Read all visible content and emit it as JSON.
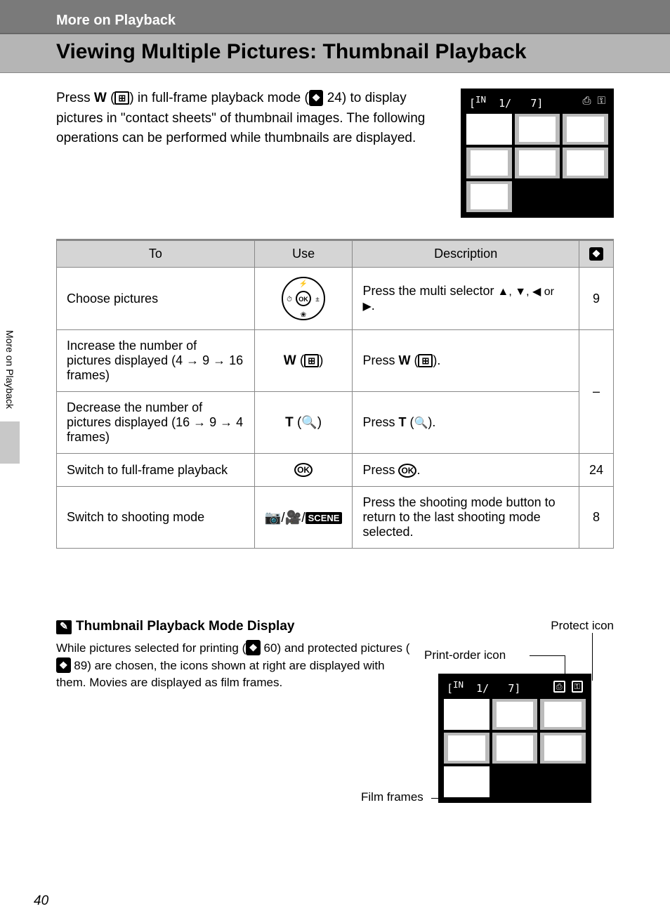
{
  "header": {
    "section": "More on Playback"
  },
  "title": "Viewing Multiple Pictures: Thumbnail Playback",
  "intro": {
    "pre": "Press ",
    "btn1": "W",
    "after_btn1": " (",
    "thumb_glyph": "⊞",
    "after_icon": ") in full-frame playback mode (",
    "ref1_page": "24",
    "post_ref1": ") to display pictures in \"contact sheets\" of thumbnail images. The following operations can be performed while thumbnails are displayed."
  },
  "thumb_display": {
    "left": "1/",
    "right": "7",
    "icons": "⎙ ⚿"
  },
  "table": {
    "headers": {
      "to": "To",
      "use": "Use",
      "desc": "Description",
      "page_icon": "❖"
    },
    "rows": [
      {
        "to": "Choose pictures",
        "use_type": "selector",
        "desc_pre": "Press the multi selector ",
        "desc_mid": "▲, ▼, ◀ or ▶",
        "desc_post": ".",
        "page": "9"
      },
      {
        "to": "Increase the number of pictures displayed (4 → 9 → 16 frames)",
        "use_type": "W",
        "desc_pre": "Press ",
        "desc_bold": "W",
        "desc_icon": " (⊞).",
        "page": "–",
        "merge_page": true
      },
      {
        "to": "Decrease the number of pictures displayed (16 → 9 → 4 frames)",
        "use_type": "T",
        "desc_pre": "Press ",
        "desc_bold": "T",
        "desc_icon": " (🔍).",
        "page": ""
      },
      {
        "to": "Switch to full-frame playback",
        "use_type": "OK",
        "desc_pre": "Press ",
        "desc_bold": "",
        "desc_icon": "ⓀⓀ",
        "desc_text": "Press ⓀⓀ.",
        "page": "24"
      },
      {
        "to": "Switch to shooting mode",
        "use_type": "mode",
        "desc_text": "Press the shooting mode button to return to the last shooting mode selected.",
        "page": "8"
      }
    ]
  },
  "note": {
    "title": "Thumbnail Playback Mode Display",
    "body_pre": "While pictures selected for printing (",
    "ref_print": "60",
    "body_mid": ") and protected pictures (",
    "ref_protect": "89",
    "body_post": ") are chosen, the icons shown at right are displayed with them. Movies are displayed as film frames.",
    "labels": {
      "protect": "Protect icon",
      "print": "Print-order icon",
      "film": "Film frames"
    }
  },
  "sidebar_label": "More on Playback",
  "page_number": "40"
}
